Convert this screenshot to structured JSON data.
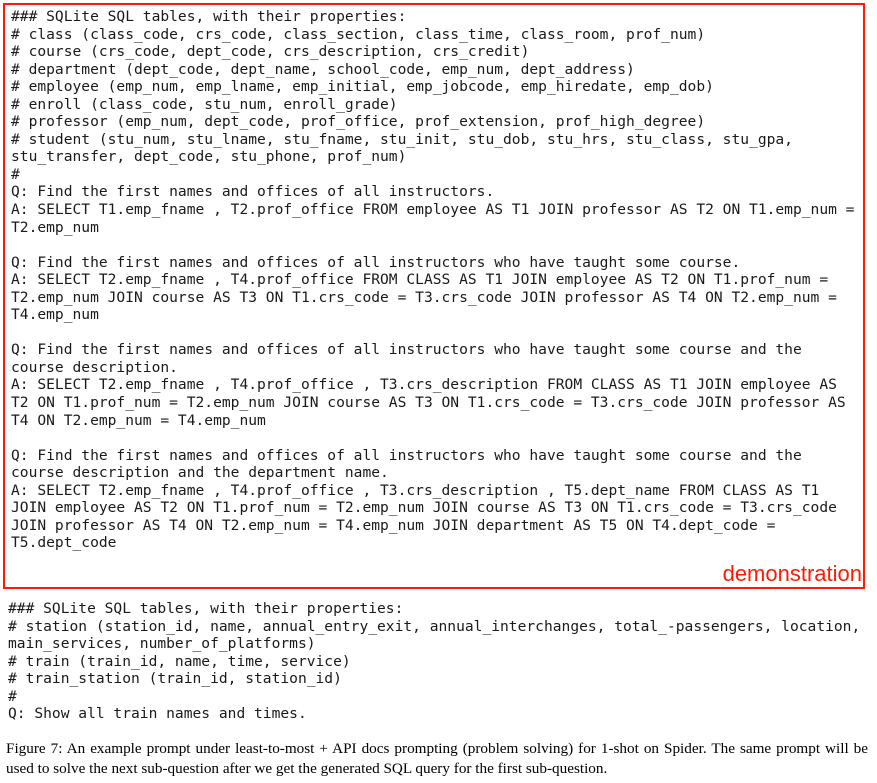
{
  "demonstration": {
    "label": "demonstration",
    "border_color": "#ff1a00",
    "prompt_text": "### SQLite SQL tables, with their properties:\n# class (class_code, crs_code, class_section, class_time, class_room, prof_num)\n# course (crs_code, dept_code, crs_description, crs_credit)\n# department (dept_code, dept_name, school_code, emp_num, dept_address)\n# employee (emp_num, emp_lname, emp_initial, emp_jobcode, emp_hiredate, emp_dob)\n# enroll (class_code, stu_num, enroll_grade)\n# professor (emp_num, dept_code, prof_office, prof_extension, prof_high_degree)\n# student (stu_num, stu_lname, stu_fname, stu_init, stu_dob, stu_hrs, stu_class, stu_gpa, stu_transfer, dept_code, stu_phone, prof_num)\n#\nQ: Find the first names and offices of all instructors.\nA: SELECT T1.emp_fname , T2.prof_office FROM employee AS T1 JOIN professor AS T2 ON T1.emp_num = T2.emp_num\n\nQ: Find the first names and offices of all instructors who have taught some course.\nA: SELECT T2.emp_fname , T4.prof_office FROM CLASS AS T1 JOIN employee AS T2 ON T1.prof_num = T2.emp_num JOIN course AS T3 ON T1.crs_code = T3.crs_code JOIN professor AS T4 ON T2.emp_num = T4.emp_num\n\nQ: Find the first names and offices of all instructors who have taught some course and the course description.\nA: SELECT T2.emp_fname , T4.prof_office , T3.crs_description FROM CLASS AS T1 JOIN employee AS T2 ON T1.prof_num = T2.emp_num JOIN course AS T3 ON T1.crs_code = T3.crs_code JOIN professor AS T4 ON T2.emp_num = T4.emp_num\n\nQ: Find the first names and offices of all instructors who have taught some course and the course description and the department name.\nA: SELECT T2.emp_fname , T4.prof_office , T3.crs_description , T5.dept_name FROM CLASS AS T1 JOIN employee AS T2 ON T1.prof_num = T2.emp_num JOIN course AS T3 ON T1.crs_code = T3.crs_code JOIN professor AS T4 ON T2.emp_num = T4.emp_num JOIN department AS T5 ON T4.dept_code = T5.dept_code"
  },
  "test_prompt": {
    "text": "### SQLite SQL tables, with their properties:\n# station (station_id, name, annual_entry_exit, annual_interchanges, total_-passengers, location, main_services, number_of_platforms)\n# train (train_id, name, time, service)\n# train_station (train_id, station_id)\n#\nQ: Show all train names and times."
  },
  "caption": {
    "text": "Figure 7: An example prompt under least-to-most + API docs prompting (problem solving) for 1-shot on Spider. The same prompt will be used to solve the next sub-question after we get the generated SQL query for the first sub-question."
  }
}
